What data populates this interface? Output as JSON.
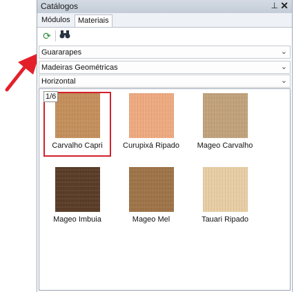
{
  "window": {
    "title": "Catálogos"
  },
  "tabs": [
    {
      "label": "Módulos",
      "active": false
    },
    {
      "label": "Materiais",
      "active": true
    }
  ],
  "toolbar": {
    "buttons": [
      {
        "icon": "refresh-icon"
      },
      {
        "icon": "binoculars-icon"
      }
    ]
  },
  "filters": {
    "manufacturer": "Guararapes",
    "collection": "Madeiras Geométricas",
    "orientation": "Horizontal"
  },
  "gallery": {
    "page_indicator": "1/6",
    "items": [
      {
        "label": "Carvalho Capri",
        "color": "#c48f5c",
        "selected": true
      },
      {
        "label": "Curupixá Ripado",
        "color": "#eeaa80",
        "selected": false
      },
      {
        "label": "Mageo Carvalho",
        "color": "#c1a27b",
        "selected": false
      },
      {
        "label": "Mageo Imbuia",
        "color": "#5a3d28",
        "selected": false
      },
      {
        "label": "Mageo Mel",
        "color": "#9e7448",
        "selected": false
      },
      {
        "label": "Tauari Ripado",
        "color": "#e8cda5",
        "selected": false
      }
    ]
  },
  "colors": {
    "selection_outline": "#d21f2b",
    "annotation_arrow": "#e3202a"
  }
}
